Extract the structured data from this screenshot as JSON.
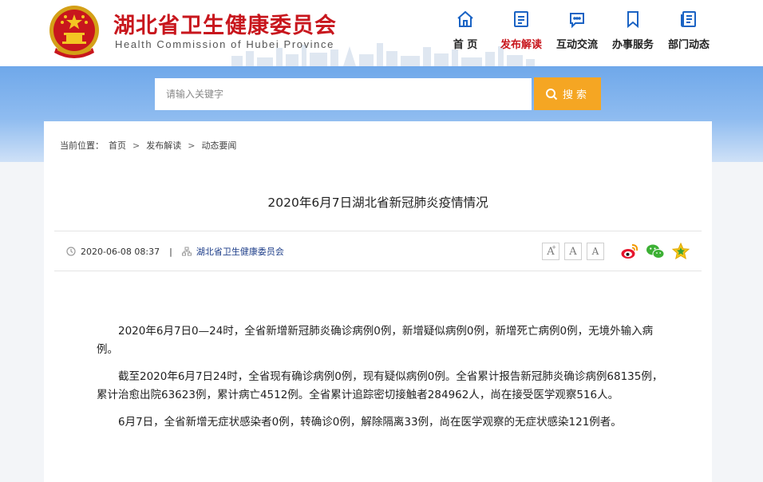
{
  "header": {
    "title": "湖北省卫生健康委员会",
    "subtitle": "Health Commission of Hubei Province"
  },
  "nav": {
    "items": [
      {
        "label": "首 页",
        "icon": "home-icon"
      },
      {
        "label": "发布解读",
        "icon": "document-icon",
        "active": true
      },
      {
        "label": "互动交流",
        "icon": "chat-icon"
      },
      {
        "label": "办事服务",
        "icon": "bookmark-icon"
      },
      {
        "label": "部门动态",
        "icon": "news-icon"
      }
    ]
  },
  "search": {
    "placeholder": "请输入关键字",
    "button_label": "搜索"
  },
  "breadcrumb": {
    "prefix": "当前位置：",
    "items": [
      "首页",
      "发布解读",
      "动态要闻"
    ],
    "separator": ">"
  },
  "article": {
    "title": "2020年6月7日湖北省新冠肺炎疫情情况",
    "datetime": "2020-06-08 08:37",
    "source": "湖北省卫生健康委员会",
    "paragraphs": [
      "2020年6月7日0—24时，全省新增新冠肺炎确诊病例0例，新增疑似病例0例，新增死亡病例0例，无境外输入病例。",
      "截至2020年6月7日24时，全省现有确诊病例0例，现有疑似病例0例。全省累计报告新冠肺炎确诊病例68135例，累计治愈出院63623例，累计病亡4512例。全省累计追踪密切接触者284962人，尚在接受医学观察516人。",
      "6月7日，全省新增无症状感染者0例，转确诊0例，解除隔离33例，尚在医学观察的无症状感染121例者。"
    ]
  },
  "tools": {
    "font_large": "A",
    "font_large_sup": "+",
    "font_medium": "A",
    "font_small": "A"
  },
  "colors": {
    "brand_red": "#c8161d",
    "search_orange": "#f5a623",
    "band_blue": "#6fa8ea",
    "source_blue": "#1f3f8a"
  }
}
